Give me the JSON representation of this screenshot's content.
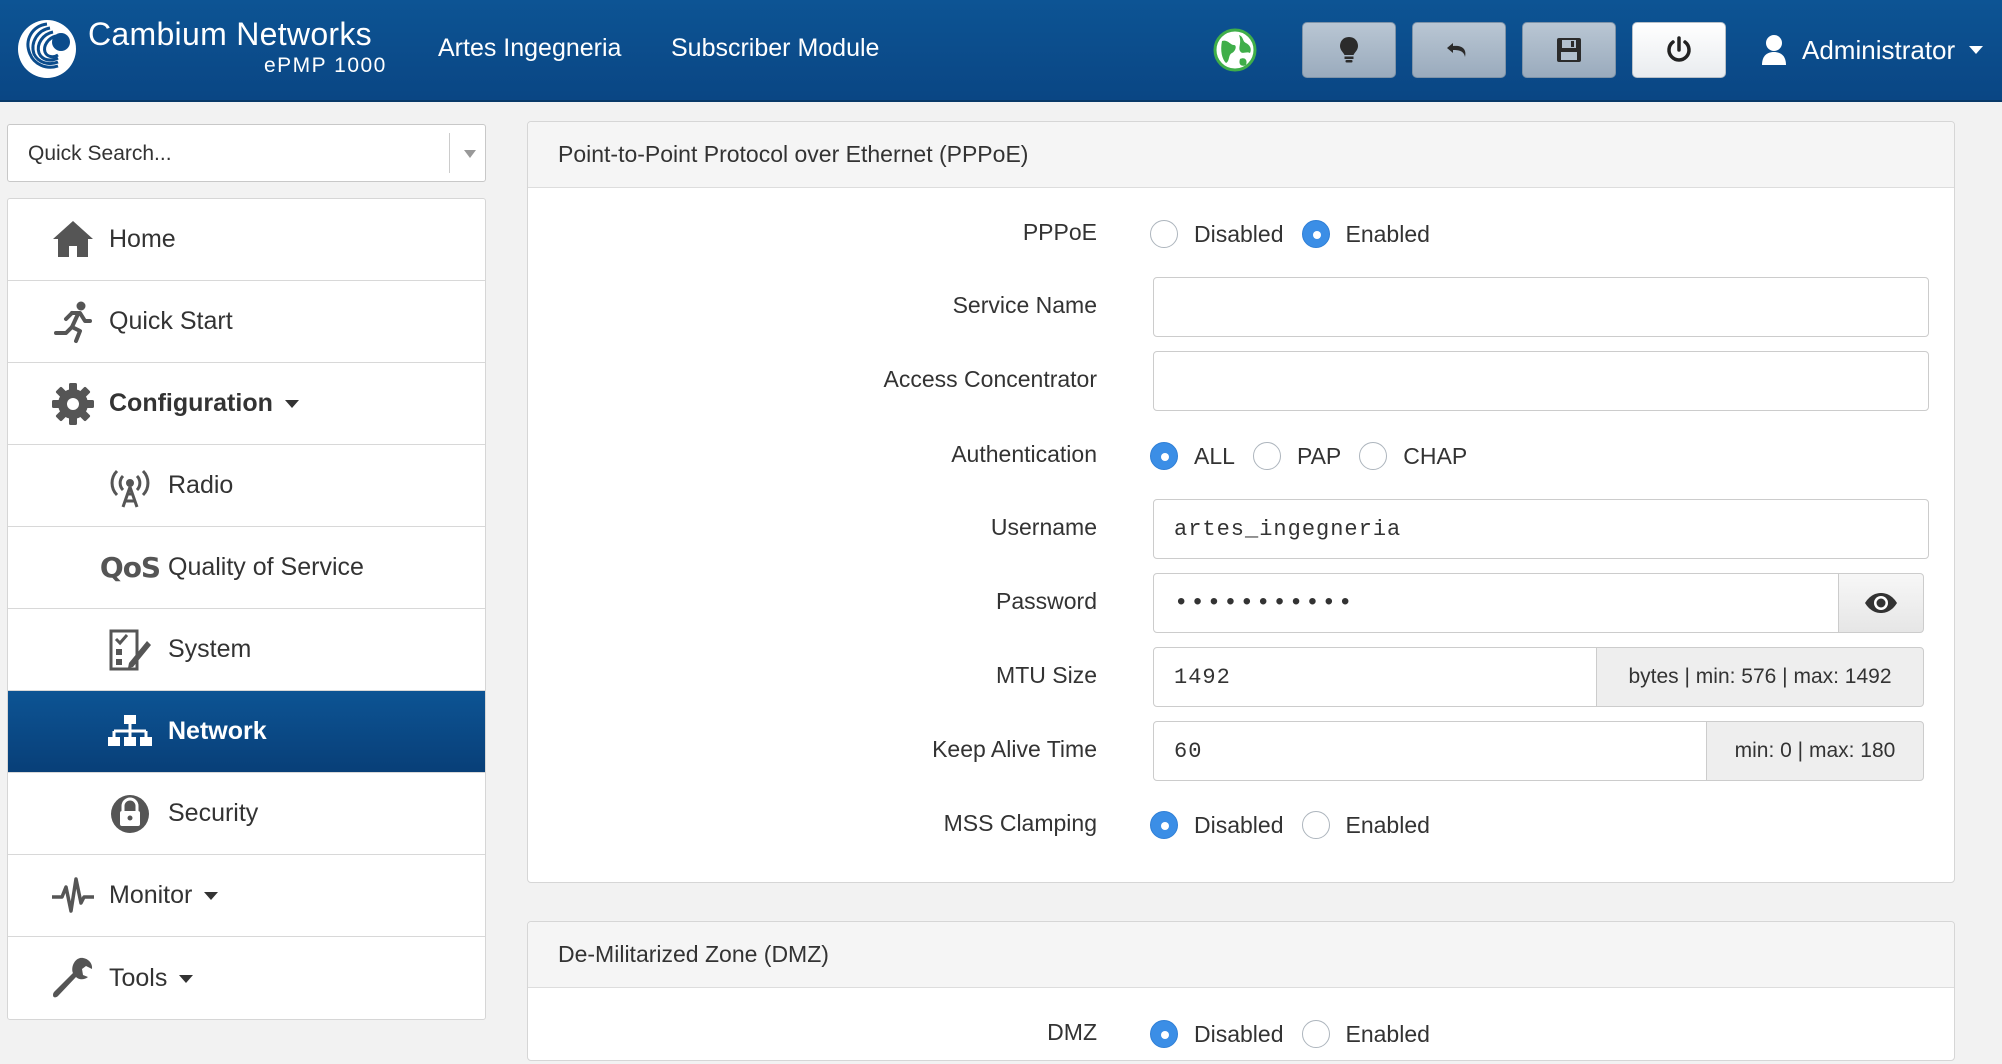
{
  "header": {
    "brand_title": "Cambium Networks",
    "brand_subtitle": "ePMP 1000",
    "site_name": "Artes Ingegneria",
    "device_mode": "Subscriber Module",
    "user_label": "Administrator",
    "toolbar_icons": [
      "lightbulb-icon",
      "undo-icon",
      "save-icon",
      "power-icon"
    ],
    "status_icon": "globe-icon",
    "accent_green": "#3fae49"
  },
  "search": {
    "placeholder": "Quick Search..."
  },
  "sidebar": {
    "items": [
      {
        "label": "Home",
        "icon": "home-icon"
      },
      {
        "label": "Quick Start",
        "icon": "running-person-icon"
      },
      {
        "label": "Configuration",
        "icon": "gear-icon"
      },
      {
        "label": "Radio",
        "icon": "radio-tower-icon"
      },
      {
        "label": "Quality of Service",
        "icon": "qos-icon",
        "icon_text": "QoS"
      },
      {
        "label": "System",
        "icon": "system-checklist-icon"
      },
      {
        "label": "Network",
        "icon": "network-icon",
        "active": true
      },
      {
        "label": "Security",
        "icon": "lock-icon"
      },
      {
        "label": "Monitor",
        "icon": "pulse-icon"
      },
      {
        "label": "Tools",
        "icon": "wrench-icon"
      }
    ]
  },
  "pppoe": {
    "title": "Point-to-Point Protocol over Ethernet (PPPoE)",
    "pppoe_label": "PPPoE",
    "pppoe_options": [
      "Disabled",
      "Enabled"
    ],
    "pppoe_selected": "Enabled",
    "service_name_label": "Service Name",
    "service_name_value": "",
    "access_concentrator_label": "Access Concentrator",
    "access_concentrator_value": "",
    "authentication_label": "Authentication",
    "authentication_options": [
      "ALL",
      "PAP",
      "CHAP"
    ],
    "authentication_selected": "ALL",
    "username_label": "Username",
    "username_value": "artes_ingegneria",
    "password_label": "Password",
    "password_value": "•••••••••••",
    "mtu_label": "MTU Size",
    "mtu_value": "1492",
    "mtu_hint": "bytes | min: 576 | max: 1492",
    "keepalive_label": "Keep Alive Time",
    "keepalive_value": "60",
    "keepalive_hint": "min: 0 | max: 180",
    "mss_label": "MSS Clamping",
    "mss_options": [
      "Disabled",
      "Enabled"
    ],
    "mss_selected": "Disabled"
  },
  "dmz": {
    "title": "De-Militarized Zone (DMZ)",
    "dmz_label": "DMZ",
    "dmz_options": [
      "Disabled",
      "Enabled"
    ],
    "dmz_selected": "Disabled"
  },
  "colors": {
    "header_blue": "#0b4c8c",
    "active_item": "#0a4a88",
    "radio_selected": "#3b8ee6"
  }
}
